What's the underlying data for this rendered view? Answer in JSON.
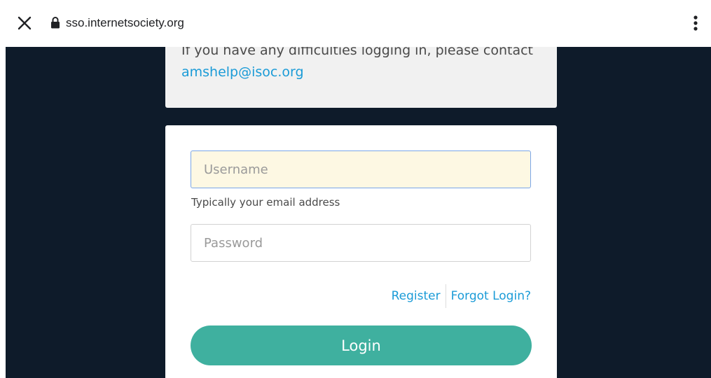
{
  "browser": {
    "url": "sso.internetsociety.org",
    "close_icon": "close-icon",
    "lock_icon": "lock-icon",
    "menu_icon": "more-vert-icon"
  },
  "notice": {
    "text": "If you have any difficulties logging in, please contact",
    "email": "amshelp@isoc.org"
  },
  "form": {
    "username_placeholder": "Username",
    "username_helper": "Typically your email address",
    "password_placeholder": "Password",
    "register_label": "Register",
    "forgot_label": "Forgot Login?",
    "login_label": "Login"
  },
  "colors": {
    "page_background": "#0e1b2a",
    "link": "#1a9bd7",
    "login_button": "#3fb09f",
    "autofill_background": "#fdf8e3"
  }
}
